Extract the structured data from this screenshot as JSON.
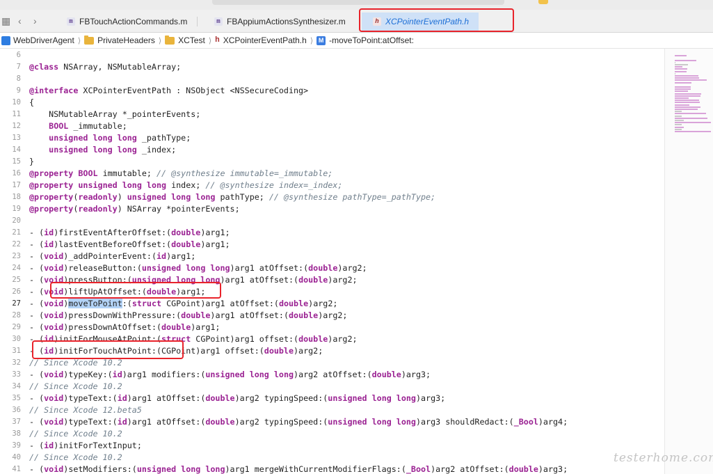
{
  "tabs": [
    {
      "label": "FBTouchActionCommands.m",
      "type": "m"
    },
    {
      "label": "FBAppiumActionsSynthesizer.m",
      "type": "m"
    },
    {
      "label": "XCPointerEventPath.h",
      "type": "h"
    }
  ],
  "breadcrumb": {
    "project": "WebDriverAgent",
    "folder1": "PrivateHeaders",
    "folder2": "XCTest",
    "file": "XCPointerEventPath.h",
    "method": "-moveToPoint:atOffset:",
    "file_badge": "h",
    "method_badge": "M"
  },
  "current_line": "27",
  "watermark": "testerhome.com",
  "code_lines": [
    {
      "n": "6",
      "t": []
    },
    {
      "n": "7",
      "t": [
        [
          "@class",
          "kw"
        ],
        [
          " NSArray, NSMutableArray;",
          ""
        ]
      ]
    },
    {
      "n": "8",
      "t": []
    },
    {
      "n": "9",
      "t": [
        [
          "@interface",
          "kw"
        ],
        [
          " XCPointerEventPath : NSObject <NSSecureCoding>",
          ""
        ]
      ]
    },
    {
      "n": "10",
      "t": [
        [
          "{",
          ""
        ]
      ]
    },
    {
      "n": "11",
      "t": [
        [
          "    NSMutableArray *_pointerEvents;",
          ""
        ]
      ]
    },
    {
      "n": "12",
      "t": [
        [
          "    ",
          ""
        ],
        [
          "BOOL",
          "kw"
        ],
        [
          " _immutable;",
          ""
        ]
      ]
    },
    {
      "n": "13",
      "t": [
        [
          "    ",
          ""
        ],
        [
          "unsigned long long",
          "kw"
        ],
        [
          " _pathType;",
          ""
        ]
      ]
    },
    {
      "n": "14",
      "t": [
        [
          "    ",
          ""
        ],
        [
          "unsigned long long",
          "kw"
        ],
        [
          " _index;",
          ""
        ]
      ]
    },
    {
      "n": "15",
      "t": [
        [
          "}",
          ""
        ]
      ]
    },
    {
      "n": "16",
      "t": [
        [
          "@property",
          "kw"
        ],
        [
          " ",
          ""
        ],
        [
          "BOOL",
          "kw"
        ],
        [
          " immutable; ",
          ""
        ],
        [
          "// @synthesize immutable=_immutable;",
          "cm"
        ]
      ]
    },
    {
      "n": "17",
      "t": [
        [
          "@property",
          "kw"
        ],
        [
          " ",
          ""
        ],
        [
          "unsigned long long",
          "kw"
        ],
        [
          " index; ",
          ""
        ],
        [
          "// @synthesize index=_index;",
          "cm"
        ]
      ]
    },
    {
      "n": "18",
      "t": [
        [
          "@property",
          "kw"
        ],
        [
          "(",
          ""
        ],
        [
          "readonly",
          "kw"
        ],
        [
          ") ",
          ""
        ],
        [
          "unsigned long long",
          "kw"
        ],
        [
          " pathType; ",
          ""
        ],
        [
          "// @synthesize pathType=_pathType;",
          "cm"
        ]
      ]
    },
    {
      "n": "19",
      "t": [
        [
          "@property",
          "kw"
        ],
        [
          "(",
          ""
        ],
        [
          "readonly",
          "kw"
        ],
        [
          ") NSArray *pointerEvents;",
          ""
        ]
      ]
    },
    {
      "n": "20",
      "t": []
    },
    {
      "n": "21",
      "t": [
        [
          "- (",
          ""
        ],
        [
          "id",
          "kw"
        ],
        [
          ")firstEventAfterOffset:(",
          ""
        ],
        [
          "double",
          "kw"
        ],
        [
          ")arg1;",
          ""
        ]
      ]
    },
    {
      "n": "22",
      "t": [
        [
          "- (",
          ""
        ],
        [
          "id",
          "kw"
        ],
        [
          ")lastEventBeforeOffset:(",
          ""
        ],
        [
          "double",
          "kw"
        ],
        [
          ")arg1;",
          ""
        ]
      ]
    },
    {
      "n": "23",
      "t": [
        [
          "- (",
          ""
        ],
        [
          "void",
          "kw"
        ],
        [
          ")_addPointerEvent:(",
          ""
        ],
        [
          "id",
          "kw"
        ],
        [
          ")arg1;",
          ""
        ]
      ]
    },
    {
      "n": "24",
      "t": [
        [
          "- (",
          ""
        ],
        [
          "void",
          "kw"
        ],
        [
          ")releaseButton:(",
          ""
        ],
        [
          "unsigned long long",
          "kw"
        ],
        [
          ")arg1 atOffset:(",
          ""
        ],
        [
          "double",
          "kw"
        ],
        [
          ")arg2;",
          ""
        ]
      ]
    },
    {
      "n": "25",
      "t": [
        [
          "- (",
          ""
        ],
        [
          "void",
          "kw"
        ],
        [
          ")pressButton:(",
          ""
        ],
        [
          "unsigned long long",
          "kw"
        ],
        [
          ")arg1 atOffset:(",
          ""
        ],
        [
          "double",
          "kw"
        ],
        [
          ")arg2;",
          ""
        ]
      ]
    },
    {
      "n": "26",
      "t": [
        [
          "- (",
          ""
        ],
        [
          "void",
          "kw"
        ],
        [
          ")liftUpAtOffset:(",
          ""
        ],
        [
          "double",
          "kw"
        ],
        [
          ")arg1;",
          ""
        ]
      ]
    },
    {
      "n": "27",
      "t": [
        [
          "- (",
          ""
        ],
        [
          "void",
          "kw"
        ],
        [
          ")",
          ""
        ],
        [
          "moveToPoint",
          "hl"
        ],
        [
          ":(",
          ""
        ],
        [
          "struct",
          "kw"
        ],
        [
          " CGPoint)arg1 atOffset:(",
          ""
        ],
        [
          "double",
          "kw"
        ],
        [
          ")arg2;",
          ""
        ]
      ]
    },
    {
      "n": "28",
      "t": [
        [
          "- (",
          ""
        ],
        [
          "void",
          "kw"
        ],
        [
          ")pressDownWithPressure:(",
          ""
        ],
        [
          "double",
          "kw"
        ],
        [
          ")arg1 atOffset:(",
          ""
        ],
        [
          "double",
          "kw"
        ],
        [
          ")arg2;",
          ""
        ]
      ]
    },
    {
      "n": "29",
      "t": [
        [
          "- (",
          ""
        ],
        [
          "void",
          "kw"
        ],
        [
          ")pressDownAtOffset:(",
          ""
        ],
        [
          "double",
          "kw"
        ],
        [
          ")arg1;",
          ""
        ]
      ]
    },
    {
      "n": "30",
      "t": [
        [
          "- (",
          ""
        ],
        [
          "id",
          "kw"
        ],
        [
          ")initForMouseAtPoint:(",
          ""
        ],
        [
          "struct",
          "kw"
        ],
        [
          " CGPoint)arg1 offset:(",
          ""
        ],
        [
          "double",
          "kw"
        ],
        [
          ")arg2;",
          ""
        ]
      ]
    },
    {
      "n": "31",
      "t": [
        [
          "- (",
          ""
        ],
        [
          "id",
          "kw"
        ],
        [
          ")initForTouchAtPoint:(CGPoint)arg1 offset:(",
          ""
        ],
        [
          "double",
          "kw"
        ],
        [
          ")arg2;",
          ""
        ]
      ]
    },
    {
      "n": "32",
      "t": [
        [
          "// Since Xcode 10.2",
          "cm"
        ]
      ]
    },
    {
      "n": "33",
      "t": [
        [
          "- (",
          ""
        ],
        [
          "void",
          "kw"
        ],
        [
          ")typeKey:(",
          ""
        ],
        [
          "id",
          "kw"
        ],
        [
          ")arg1 modifiers:(",
          ""
        ],
        [
          "unsigned long long",
          "kw"
        ],
        [
          ")arg2 atOffset:(",
          ""
        ],
        [
          "double",
          "kw"
        ],
        [
          ")arg3;",
          ""
        ]
      ]
    },
    {
      "n": "34",
      "t": [
        [
          "// Since Xcode 10.2",
          "cm"
        ]
      ]
    },
    {
      "n": "35",
      "t": [
        [
          "- (",
          ""
        ],
        [
          "void",
          "kw"
        ],
        [
          ")typeText:(",
          ""
        ],
        [
          "id",
          "kw"
        ],
        [
          ")arg1 atOffset:(",
          ""
        ],
        [
          "double",
          "kw"
        ],
        [
          ")arg2 typingSpeed:(",
          ""
        ],
        [
          "unsigned long long",
          "kw"
        ],
        [
          ")arg3;",
          ""
        ]
      ]
    },
    {
      "n": "36",
      "t": [
        [
          "// Since Xcode 12.beta5",
          "cm"
        ]
      ]
    },
    {
      "n": "37",
      "t": [
        [
          "- (",
          ""
        ],
        [
          "void",
          "kw"
        ],
        [
          ")typeText:(",
          ""
        ],
        [
          "id",
          "kw"
        ],
        [
          ")arg1 atOffset:(",
          ""
        ],
        [
          "double",
          "kw"
        ],
        [
          ")arg2 typingSpeed:(",
          ""
        ],
        [
          "unsigned long long",
          "kw"
        ],
        [
          ")arg3 shouldRedact:(",
          ""
        ],
        [
          "_Bool",
          "kw"
        ],
        [
          ")arg4;",
          ""
        ]
      ]
    },
    {
      "n": "38",
      "t": [
        [
          "// Since Xcode 10.2",
          "cm"
        ]
      ]
    },
    {
      "n": "39",
      "t": [
        [
          "- (",
          ""
        ],
        [
          "id",
          "kw"
        ],
        [
          ")initForTextInput;",
          ""
        ]
      ]
    },
    {
      "n": "40",
      "t": [
        [
          "// Since Xcode 10.2",
          "cm"
        ]
      ]
    },
    {
      "n": "41",
      "t": [
        [
          "- (",
          ""
        ],
        [
          "void",
          "kw"
        ],
        [
          ")setModifiers:(",
          ""
        ],
        [
          "unsigned long long",
          "kw"
        ],
        [
          ")arg1 mergeWithCurrentModifierFlags:(",
          ""
        ],
        [
          "_Bool",
          "kw"
        ],
        [
          ")arg2 atOffset:(",
          ""
        ],
        [
          "double",
          "kw"
        ],
        [
          ")arg3;",
          ""
        ]
      ]
    }
  ]
}
